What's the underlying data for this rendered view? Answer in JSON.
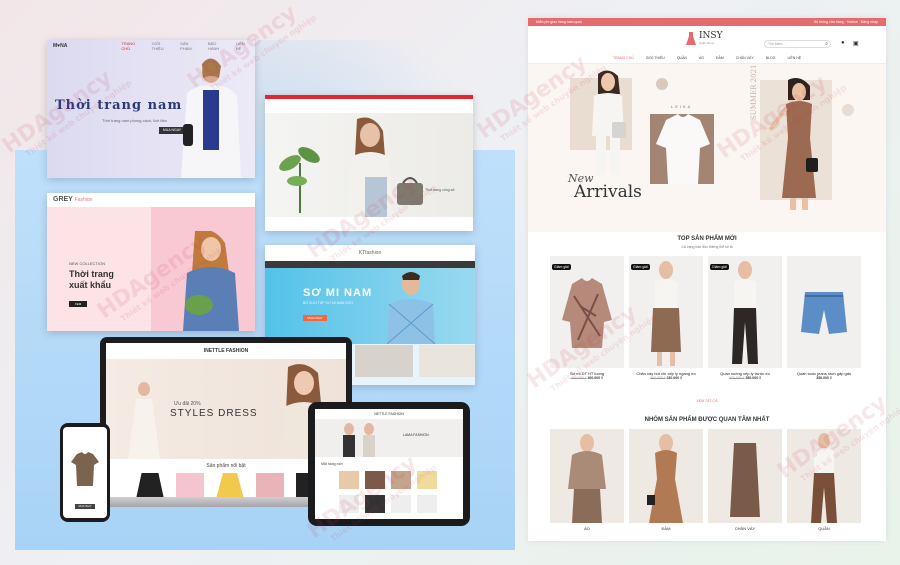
{
  "shot_mona": {
    "logo": "M♥NA",
    "nav": [
      "TRANG CHỦ",
      "GIỚI THIỆU",
      "SẢN PHẨM",
      "BẢO HÀNH",
      "LIÊN HỆ"
    ],
    "title": "Thời trang nam",
    "subtitle": "Thời trang nam phong cách, lịch lãm",
    "button": "MUA NGAY"
  },
  "shot_red": {
    "hero_note": "Thời trang công sở"
  },
  "shot_grey": {
    "brand": "GREY",
    "brand_sub": "Fashion",
    "tag": "NEW COLLECTION",
    "headline_1": "Thời trang",
    "headline_2": "xuất khẩu",
    "button": "XEM"
  },
  "shot_somi": {
    "header": "KTfashion",
    "title": "SƠ MI NAM",
    "subtitle": "BỘ SƯU TẬP SƠ MI NAM 2021",
    "button": "MUA NGAY"
  },
  "laptop": {
    "header": "INETTLE FASHION",
    "offer": "Ưu đãi 20%",
    "headline": "STYLES DRESS",
    "section": "Sản phẩm nổi bật"
  },
  "tablet": {
    "header": "NETTLE FASHION",
    "promo": "LAMA FASHION",
    "section": "Mặt hàng mới"
  },
  "phone": {
    "button": "MUA NGAY"
  },
  "insy": {
    "top_left": "Miễn phí giao hàng toàn quốc",
    "top_right": "Hệ thống cửa hàng · Hotline · Đăng nhập",
    "logo_name": "INSY",
    "logo_sub": "Night Moon",
    "search_placeholder": "Tìm kiếm...",
    "menu": [
      "TRANG CHỦ",
      "GIỚI THIỆU",
      "QUẦN",
      "ÁO",
      "ĐẦM",
      "CHÂN VÁY",
      "BLOG",
      "LIÊN HỆ"
    ],
    "hero_leika": "LEIKA",
    "hero_summer": "SUMMER 2021",
    "hero_new": "New",
    "hero_arrivals": "Arrivals",
    "top_title": "TOP SẢN PHẨM MỚI",
    "top_sub": "Cà vạng hàn độc thiếng thể ké là",
    "badge": "Giảm giá!",
    "products": [
      {
        "name": "Sơ mi DT HT luong",
        "old": "460.000 ₫",
        "price": "400.000 ₫"
      },
      {
        "name": "Chân váy bút chì xếp ly ngang eo",
        "old": "260.000 ₫",
        "price": "230.000 ₫"
      },
      {
        "name": "Quần suông xếp ly trước eo",
        "old": "400.000 ₫",
        "price": "350.000 ₫"
      },
      {
        "name": "Quần soóc jeans rách gấp gấu",
        "old": "",
        "price": "350.000 ₫"
      }
    ],
    "see_all": "XEM TẤT CẢ",
    "group_title": "NHÓM SẢN PHẨM ĐƯỢC QUAN TÂM NHẤT",
    "categories": [
      "ÁO",
      "ĐẦM",
      "CHÂN VÁY",
      "QUẦN"
    ],
    "accent": "#e46b6e"
  },
  "watermark": {
    "brand": "HDAgency",
    "note": "Thiết kế web chuyên nghiệp"
  }
}
